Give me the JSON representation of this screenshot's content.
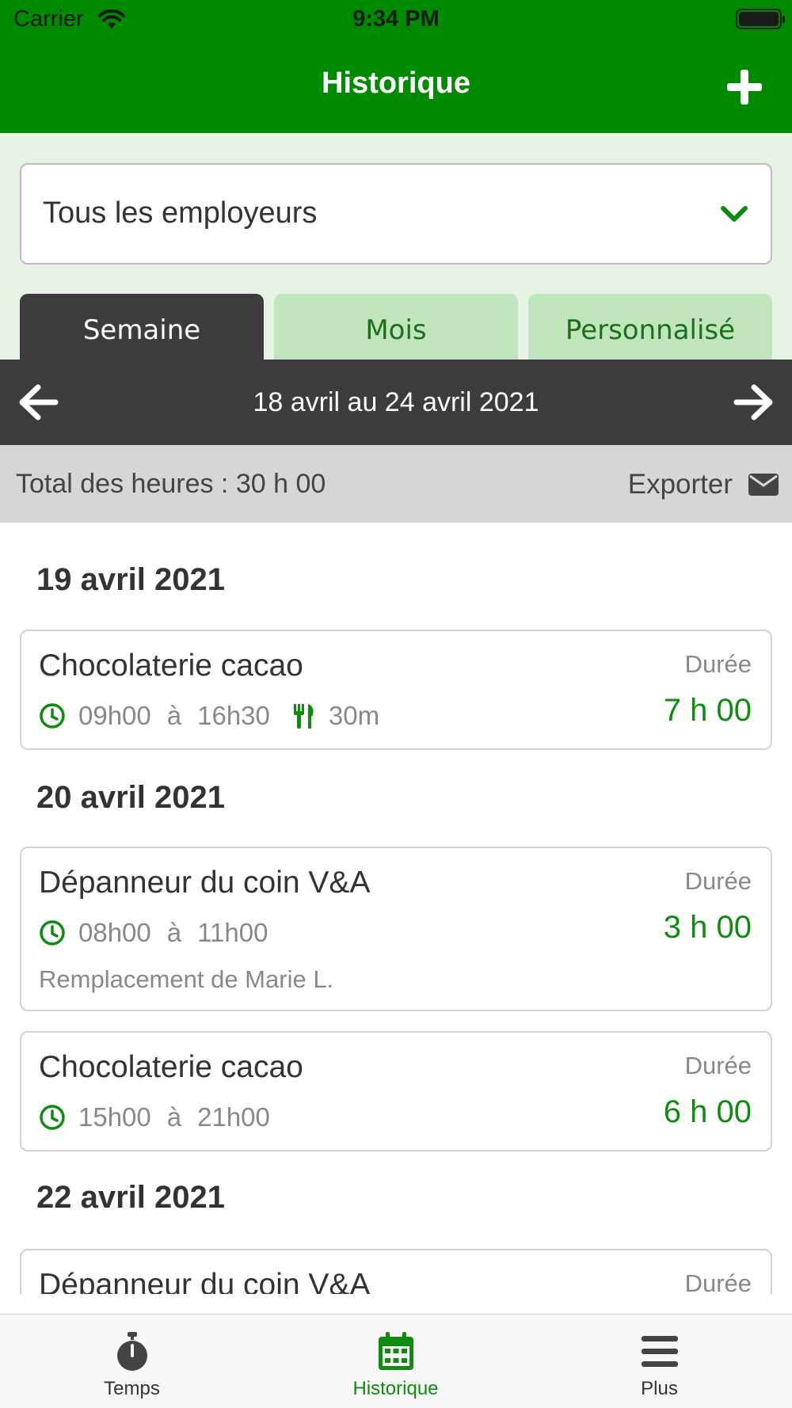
{
  "status_bar": {
    "carrier": "Carrier",
    "time": "9:34 PM"
  },
  "header": {
    "title": "Historique",
    "add_icon": "plus-icon"
  },
  "filter": {
    "employer_value": "Tous les employeurs",
    "chevron_icon": "chevron-down-icon"
  },
  "period_tabs": [
    {
      "label": "Semaine",
      "active": true
    },
    {
      "label": "Mois",
      "active": false
    },
    {
      "label": "Personnalisé",
      "active": false
    }
  ],
  "week": {
    "label": "18 avril au 24 avril 2021",
    "prev_icon": "arrow-left-icon",
    "next_icon": "arrow-right-icon"
  },
  "summary": {
    "total": "Total des heures : 30 h 00",
    "export_label": "Exporter",
    "export_icon": "envelope-icon"
  },
  "days": [
    {
      "date": "19 avril 2021",
      "entries": [
        {
          "employer": "Chocolaterie cacao",
          "start": "09h00",
          "sep": "à",
          "end": "16h30",
          "meal": "30m",
          "duration_label": "Durée",
          "duration": "7 h 00"
        }
      ]
    },
    {
      "date": "20 avril 2021",
      "entries": [
        {
          "employer": "Dépanneur du coin V&A",
          "start": "08h00",
          "sep": "à",
          "end": "11h00",
          "note": "Remplacement de Marie L.",
          "duration_label": "Durée",
          "duration": "3 h 00"
        },
        {
          "employer": "Chocolaterie cacao",
          "start": "15h00",
          "sep": "à",
          "end": "21h00",
          "duration_label": "Durée",
          "duration": "6 h 00"
        }
      ]
    },
    {
      "date": "22 avril 2021",
      "entries": [
        {
          "employer": "Dépanneur du coin V&A",
          "duration_label": "Durée"
        }
      ]
    }
  ],
  "tabbar": [
    {
      "label": "Temps",
      "icon": "stopwatch-icon",
      "active": false
    },
    {
      "label": "Historique",
      "icon": "calendar-icon",
      "active": true
    },
    {
      "label": "Plus",
      "icon": "menu-icon",
      "active": false
    }
  ],
  "colors": {
    "primary": "#008a00",
    "accent_text": "#0f8c0f",
    "dark_bar": "#3c3c3c",
    "tab_inactive": "#c0e5bc",
    "filter_bg": "#e6f3e4"
  }
}
